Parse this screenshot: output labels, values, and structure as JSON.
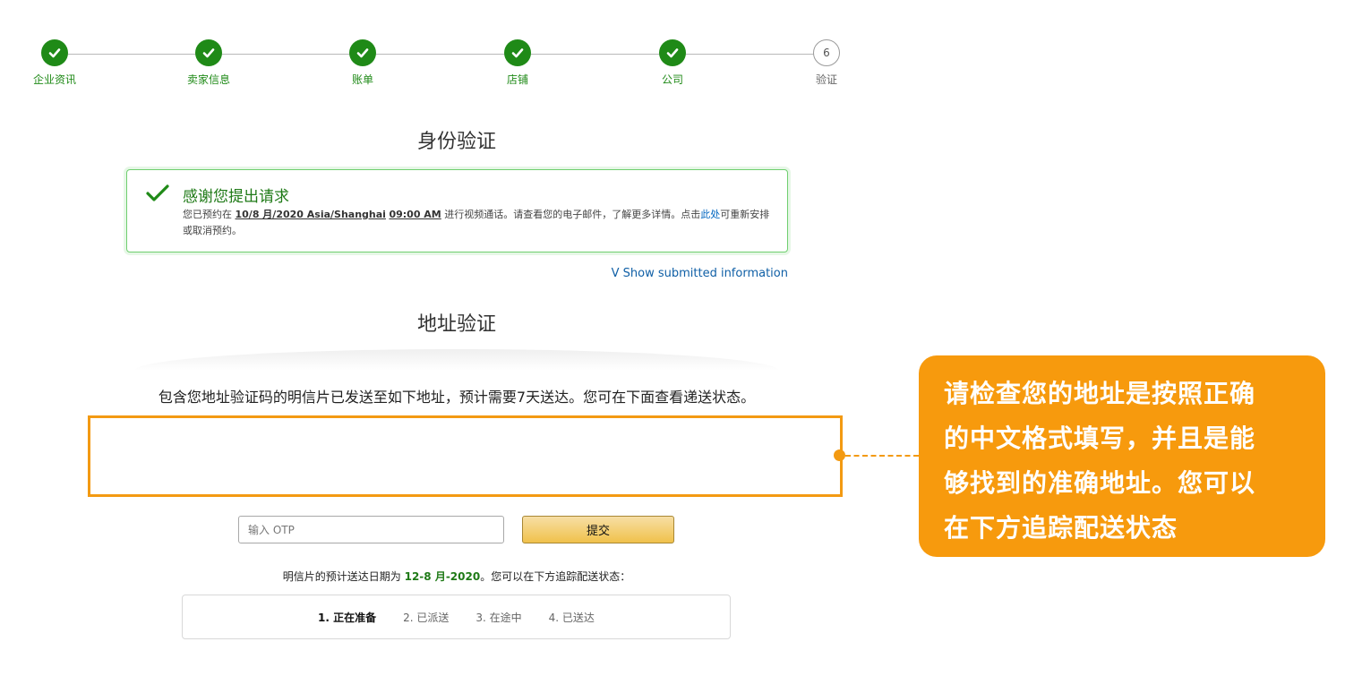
{
  "stepper": {
    "steps": [
      {
        "label": "企业资讯",
        "state": "done"
      },
      {
        "label": "卖家信息",
        "state": "done"
      },
      {
        "label": "账单",
        "state": "done"
      },
      {
        "label": "店铺",
        "state": "done"
      },
      {
        "label": "公司",
        "state": "done"
      },
      {
        "label": "验证",
        "state": "pending",
        "number": "6"
      }
    ]
  },
  "identity": {
    "title": "身份验证",
    "success_title": "感谢您提出请求",
    "body_prefix": "您已预约在 ",
    "date": "10/8 月/2020 Asia/Shanghai",
    "time": "09:00 AM",
    "body_middle": " 进行视频通话。请查看您的电子邮件，了解更多详情。点击",
    "link": "此处",
    "body_suffix": "可重新安排或取消预约。",
    "show_info": "V Show submitted information"
  },
  "address": {
    "title": "地址验证",
    "postcard_text": "包含您地址验证码的明信片已发送至如下地址，预计需要7天送达。您可在下面查看递送状态。",
    "otp_placeholder": "输入 OTP",
    "submit_label": "提交",
    "delivery_prefix": "明信片的预计送达日期为 ",
    "delivery_date": "12-8 月-2020",
    "delivery_suffix": "。您可以在下方追踪配送状态：",
    "tracking": [
      {
        "label": "1. 正在准备",
        "active": true
      },
      {
        "label": "2. 已派送",
        "active": false
      },
      {
        "label": "3. 在途中",
        "active": false
      },
      {
        "label": "4. 已送达",
        "active": false
      }
    ]
  },
  "callout": {
    "lines": [
      "请检查您的地址是按照正确",
      "的中文格式填写，并且是能",
      "够找到的准确地址。您可以",
      "在下方追踪配送状态"
    ]
  },
  "colors": {
    "success_green": "#1f8a17",
    "callout_orange": "#f79a0d",
    "link_blue": "#0066c0"
  }
}
